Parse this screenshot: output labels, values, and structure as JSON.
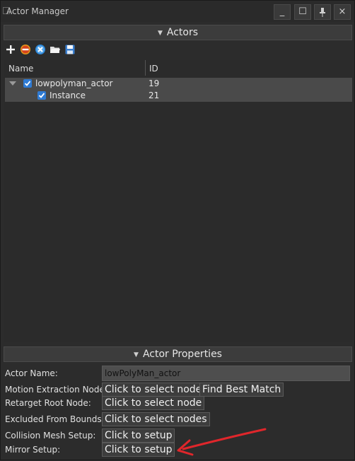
{
  "window": {
    "title": "Actor Manager"
  },
  "titlebar_buttons": [
    {
      "name": "minimize",
      "glyph": "_"
    },
    {
      "name": "maximize",
      "glyph": "☐"
    },
    {
      "name": "pin",
      "glyph": "pin-icon"
    },
    {
      "name": "close",
      "glyph": "×"
    }
  ],
  "actors_panel": {
    "header": "Actors",
    "toolbar": [
      "add-icon",
      "remove-icon",
      "clear-icon",
      "open-folder-icon",
      "save-icon"
    ],
    "columns": {
      "name": "Name",
      "id": "ID"
    },
    "rows": [
      {
        "name": "lowpolyman_actor",
        "id": "19",
        "checked": true,
        "level": 0,
        "expanded": true
      },
      {
        "name": "Instance",
        "id": "21",
        "checked": true,
        "level": 1
      }
    ]
  },
  "properties_panel": {
    "header": "Actor Properties",
    "actor_name_label": "Actor Name:",
    "actor_name_value": "lowPolyMan_actor",
    "motion_extraction_label": "Motion Extraction Node:",
    "motion_extraction_btn": "Click to select node",
    "find_best_match_btn": "Find Best Match",
    "retarget_root_label": "Retarget Root Node:",
    "retarget_root_btn": "Click to select node",
    "excluded_bounds_label": "Excluded From Bounds:",
    "excluded_bounds_btn": "Click to select nodes",
    "collision_mesh_label": "Collision Mesh Setup:",
    "collision_mesh_btn": "Click to setup",
    "mirror_setup_label": "Mirror Setup:",
    "mirror_setup_btn": "Click to setup"
  },
  "colors": {
    "accent": "#2f7bd4",
    "annotation_arrow": "#e0262b"
  }
}
